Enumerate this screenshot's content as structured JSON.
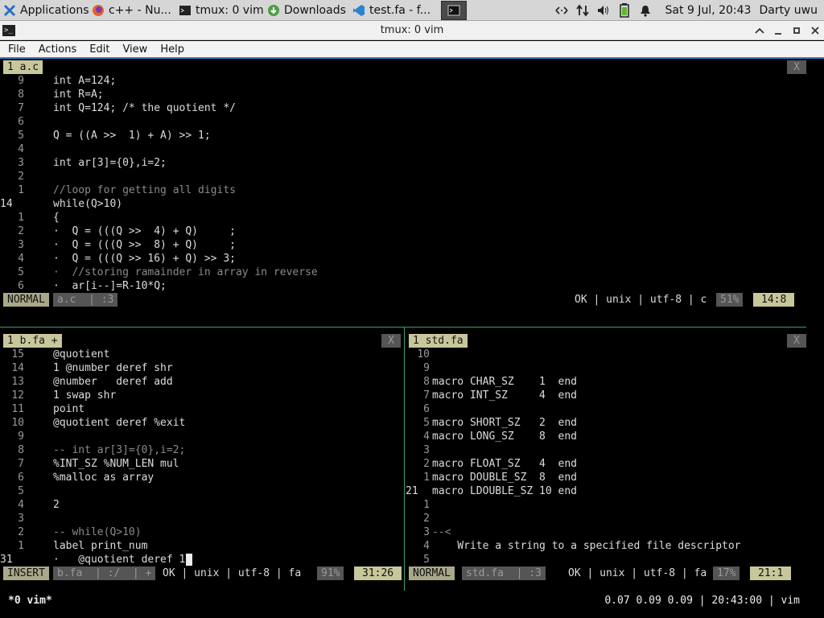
{
  "panel": {
    "tasks": [
      {
        "label": "Applications",
        "icon": "xfce-mouse-icon"
      },
      {
        "label": "c++ - Nu...",
        "icon": "firefox-icon"
      },
      {
        "label": "tmux: 0 vim",
        "icon": "terminal-icon"
      },
      {
        "label": "Downloads",
        "icon": "download-icon"
      },
      {
        "label": "test.fa - f...",
        "icon": "vscode-icon"
      }
    ],
    "clock": "Sat  9 Jul, 20:43",
    "user": "Darty uwu"
  },
  "window": {
    "title": "tmux: 0 vim"
  },
  "menu": [
    "File",
    "Actions",
    "Edit",
    "View",
    "Help"
  ],
  "top_pane": {
    "tab": "1 a.c",
    "close": "X",
    "lines": [
      {
        "n": "9",
        "code": "int A=124;"
      },
      {
        "n": "8",
        "code": "int R=A;"
      },
      {
        "n": "7",
        "code": "int Q=124; /* the quotient */"
      },
      {
        "n": "6",
        "code": ""
      },
      {
        "n": "5",
        "code": "Q = ((A >>  1) + A) >> 1;"
      },
      {
        "n": "4",
        "code": ""
      },
      {
        "n": "3",
        "code": "int ar[3]={0},i=2;"
      },
      {
        "n": "2",
        "code": ""
      },
      {
        "n": "1",
        "code": "//loop for getting all digits"
      },
      {
        "n": "14",
        "code": "while(Q>10)",
        "current": true
      },
      {
        "n": "1",
        "code": "{"
      },
      {
        "n": "2",
        "code": "·  Q = (((Q >>  4) + Q)     ;"
      },
      {
        "n": "3",
        "code": "·  Q = (((Q >>  8) + Q)     ;"
      },
      {
        "n": "4",
        "code": "·  Q = (((Q >> 16) + Q) >> 3;"
      },
      {
        "n": "5",
        "code": "·  //storing ramainder in array in reverse"
      },
      {
        "n": "6",
        "code": "·  ar[i--]=R-10*Q;"
      }
    ],
    "status": {
      "mode": "NORMAL",
      "file": "a.c  | :3",
      "info": "OK | unix | utf-8 | c",
      "percent": "51%",
      "pos": "14:8"
    }
  },
  "left_pane": {
    "tab": "1 b.fa +",
    "close": "X",
    "lines": [
      {
        "n": "15",
        "code": "@quotient"
      },
      {
        "n": "14",
        "code": "1 @number deref shr"
      },
      {
        "n": "13",
        "code": "@number   deref add"
      },
      {
        "n": "12",
        "code": "1 swap shr"
      },
      {
        "n": "11",
        "code": "point"
      },
      {
        "n": "10",
        "code": "@quotient deref %exit"
      },
      {
        "n": "9",
        "code": ""
      },
      {
        "n": "8",
        "code": "-- int ar[3]={0},i=2;"
      },
      {
        "n": "7",
        "code": "%INT_SZ %NUM_LEN mul"
      },
      {
        "n": "6",
        "code": "%malloc as array"
      },
      {
        "n": "5",
        "code": ""
      },
      {
        "n": "4",
        "code": "2"
      },
      {
        "n": "3",
        "code": ""
      },
      {
        "n": "2",
        "code": "-- while(Q>10)"
      },
      {
        "n": "1",
        "code": "label print_num"
      },
      {
        "n": "31",
        "code": "·   @quotient deref 1",
        "current": true
      }
    ],
    "status": {
      "mode": "INSERT",
      "file": "b.fa  | :/  | +",
      "info": "OK | unix | utf-8 | fa",
      "percent": "91%",
      "pos": "31:26"
    }
  },
  "right_pane": {
    "tab": "1 std.fa",
    "close": "X",
    "lines": [
      {
        "n": "10",
        "code": ""
      },
      {
        "n": "9",
        "code": ""
      },
      {
        "n": "8",
        "code": "macro CHAR_SZ    1  end"
      },
      {
        "n": "7",
        "code": "macro INT_SZ     4  end"
      },
      {
        "n": "6",
        "code": ""
      },
      {
        "n": "5",
        "code": "macro SHORT_SZ   2  end"
      },
      {
        "n": "4",
        "code": "macro LONG_SZ    8  end"
      },
      {
        "n": "3",
        "code": ""
      },
      {
        "n": "2",
        "code": "macro FLOAT_SZ   4  end"
      },
      {
        "n": "1",
        "code": "macro DOUBLE_SZ  8  end"
      },
      {
        "n": "21",
        "code": "macro LDOUBLE_SZ 10 end",
        "current": true
      },
      {
        "n": "1",
        "code": ""
      },
      {
        "n": "2",
        "code": ""
      },
      {
        "n": "3",
        "code": "--<"
      },
      {
        "n": "4",
        "code": "    Write a string to a specified file descriptor"
      },
      {
        "n": "5",
        "code": ""
      }
    ],
    "status": {
      "mode": "NORMAL",
      "file": "std.fa  | :3",
      "info": "OK | unix | utf-8 | fa",
      "percent": "17%",
      "pos": "21:1"
    }
  },
  "tmux": {
    "window": "*0 vim*",
    "right": "0.07 0.09 0.09 | 20:43:00 | vim"
  }
}
